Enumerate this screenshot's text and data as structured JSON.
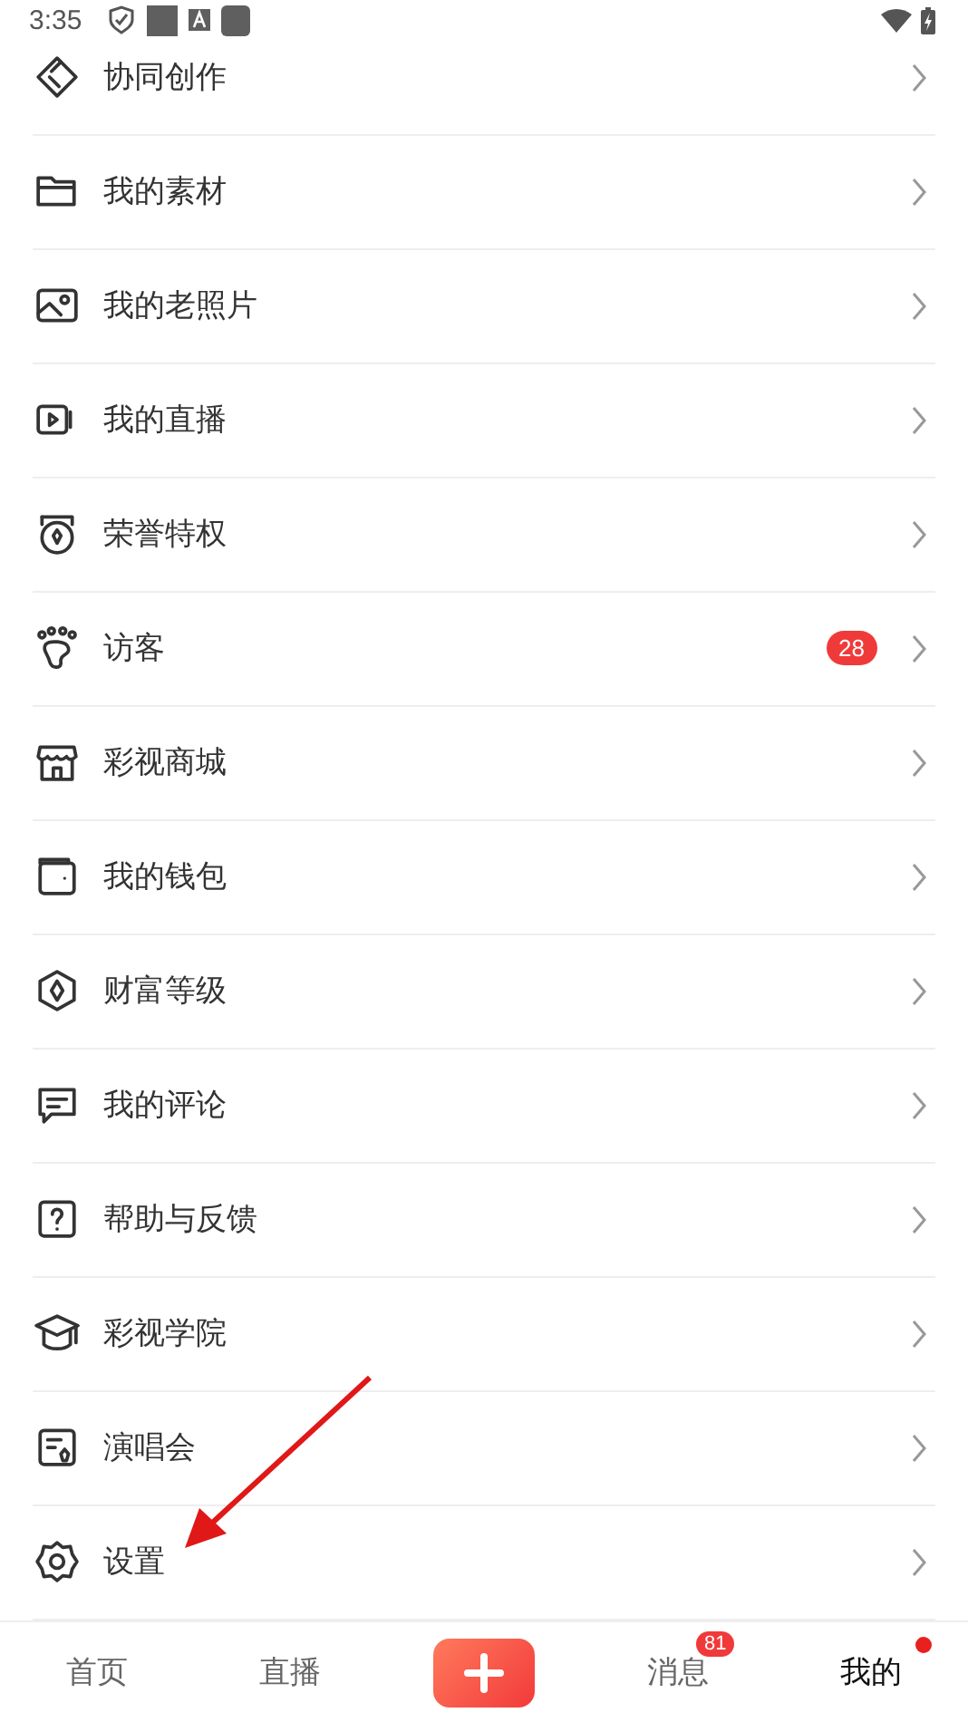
{
  "status_bar": {
    "time": "3:35"
  },
  "menu": [
    {
      "label": "协同创作"
    },
    {
      "label": "我的素材"
    },
    {
      "label": "我的老照片"
    },
    {
      "label": "我的直播"
    },
    {
      "label": "荣誉特权"
    },
    {
      "label": "访客",
      "badge": "28"
    },
    {
      "label": "彩视商城"
    },
    {
      "label": "我的钱包"
    },
    {
      "label": "财富等级"
    },
    {
      "label": "我的评论"
    },
    {
      "label": "帮助与反馈"
    },
    {
      "label": "彩视学院"
    },
    {
      "label": "演唱会"
    },
    {
      "label": "设置"
    }
  ],
  "bottom_nav": [
    {
      "kind": "tab",
      "label": "首页",
      "selected": false
    },
    {
      "kind": "tab",
      "label": "直播",
      "selected": false
    },
    {
      "kind": "create",
      "selected": false
    },
    {
      "kind": "tab",
      "label": "消息",
      "selected": false,
      "badge": "81"
    },
    {
      "kind": "tab",
      "label": "我的",
      "selected": true,
      "dot": true
    }
  ]
}
